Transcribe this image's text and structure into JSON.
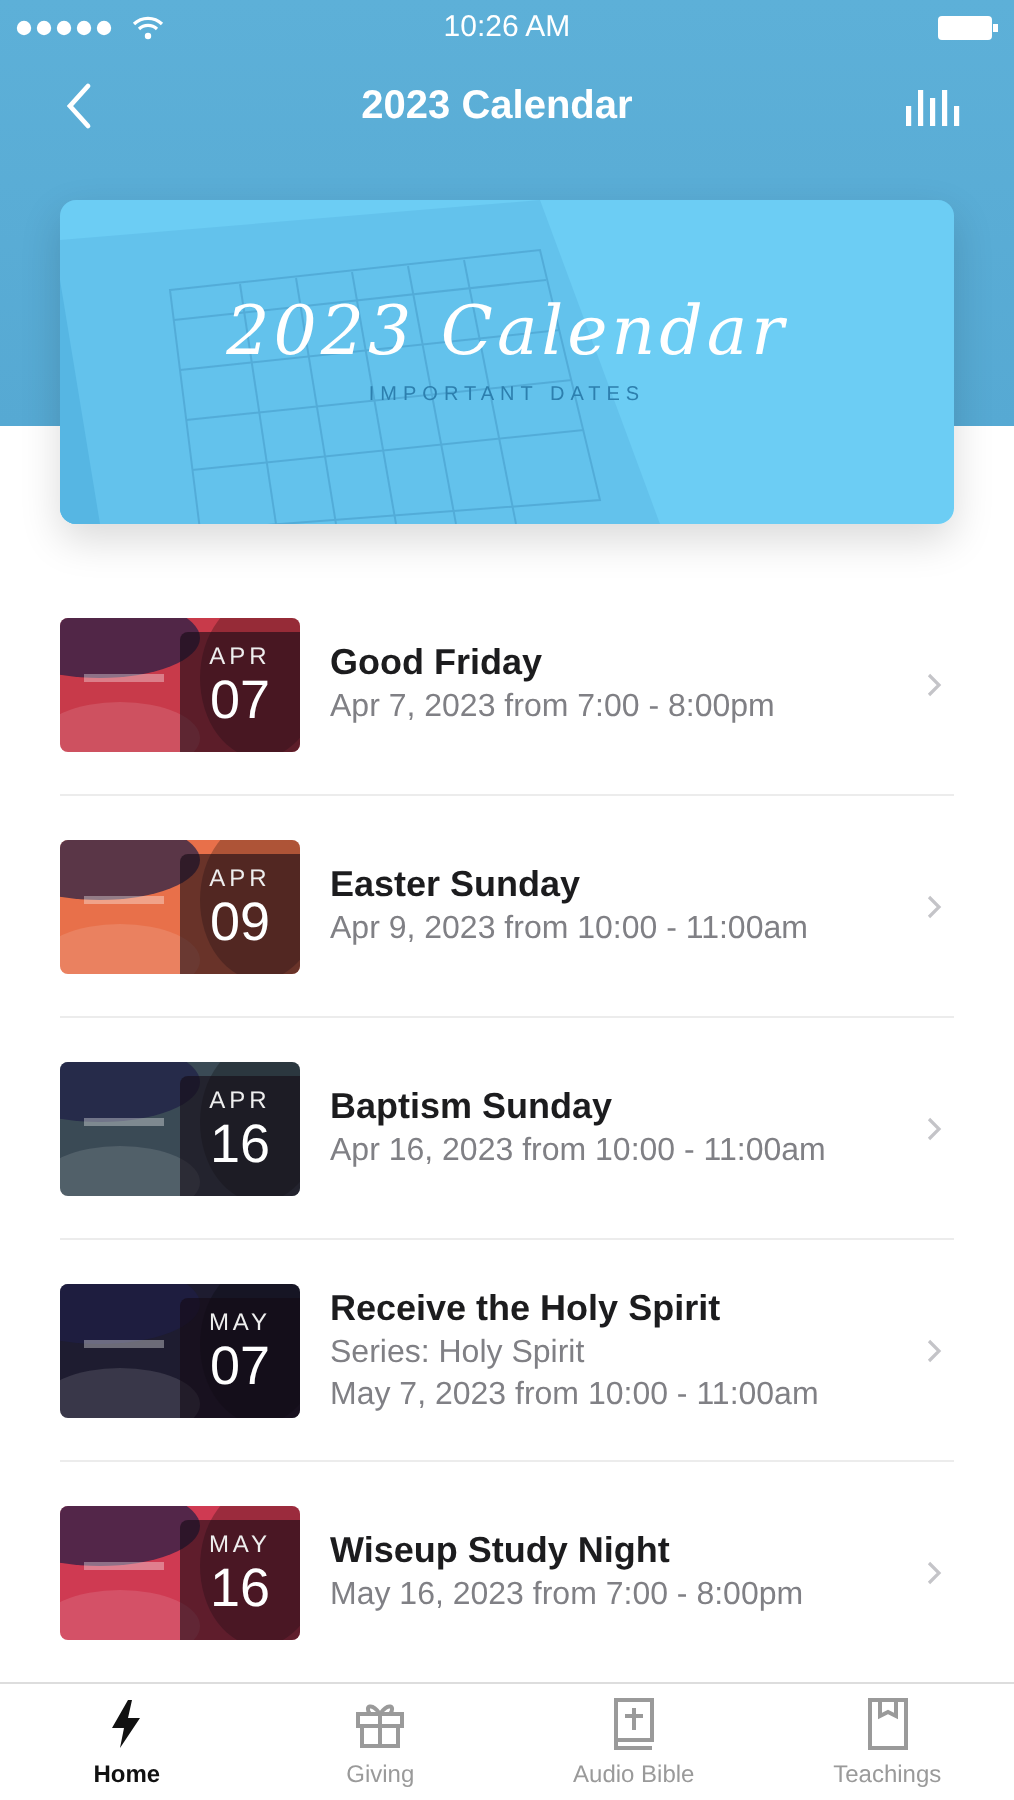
{
  "status_bar": {
    "time": "10:26 AM"
  },
  "nav": {
    "title": "2023 Calendar"
  },
  "banner": {
    "kind": "picture",
    "title": "2023 Calendar",
    "subtitle": "IMPORTANT DATES"
  },
  "events": [
    {
      "title": "Good Friday",
      "details": [
        "Apr 7, 2023 from 7:00 - 8:00pm"
      ],
      "month": "APR",
      "day": "07"
    },
    {
      "title": "Easter Sunday",
      "details": [
        "Apr 9, 2023 from 10:00 - 11:00am"
      ],
      "month": "APR",
      "day": "09"
    },
    {
      "title": "Baptism Sunday",
      "details": [
        "Apr 16, 2023 from 10:00 - 11:00am"
      ],
      "month": "APR",
      "day": "16"
    },
    {
      "title": "Receive the Holy Spirit",
      "details": [
        "Series: Holy Spirit",
        "May 7, 2023 from 10:00 - 11:00am"
      ],
      "month": "MAY",
      "day": "07"
    },
    {
      "title": "Wiseup Study Night",
      "details": [
        "May 16, 2023 from 7:00 - 8:00pm"
      ],
      "month": "MAY",
      "day": "16"
    }
  ],
  "tabs": [
    {
      "label": "Home",
      "selected": true
    },
    {
      "label": "Giving",
      "selected": false
    },
    {
      "label": "Audio Bible",
      "selected": false
    },
    {
      "label": "Teachings",
      "selected": false
    }
  ]
}
